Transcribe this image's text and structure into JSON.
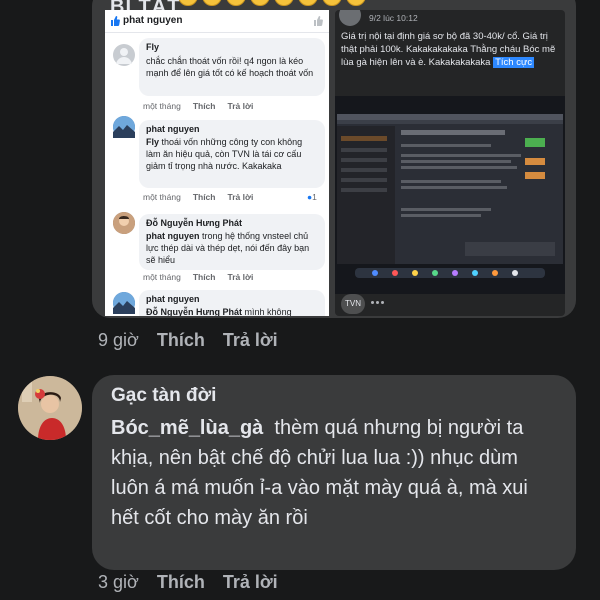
{
  "top_comment": {
    "title_fragment": "BỊ TẠT",
    "emoji_count": 8,
    "time": "9 giờ",
    "like_label": "Thích",
    "reply_label": "Trả lời"
  },
  "left_screenshot": {
    "header_name": "phat nguyen",
    "comments": [
      {
        "name": "Fly",
        "text": "chắc chắn thoát vốn rồi! q4 ngon là kéo mạnh để lên giá tốt có kế hoạch thoát vốn",
        "time": "một tháng",
        "like": "Thích",
        "reply": "Trả lời"
      },
      {
        "name": "phat nguyen",
        "mention": "Fly",
        "text": "thoái vốn những công ty con không làm ăn hiệu quả, còn TVN là tái cơ cấu giảm tỉ trọng nhà nước. Kakakaka",
        "time": "một tháng",
        "like": "Thích",
        "reply": "Trả lời",
        "reaction_count": "1"
      },
      {
        "name": "Đỗ Nguyễn Hưng Phát",
        "mention": "phat nguyen",
        "text": "trong hệ thống vnsteel chủ lực thép dài và thép dẹt, nói đến đây bạn sẽ hiểu",
        "time": "một tháng",
        "like": "Thích",
        "reply": "Trả lời"
      },
      {
        "name": "phat nguyen",
        "mention": "Đỗ Nguyễn Hưng Phát",
        "text": "mình không"
      }
    ]
  },
  "right_screenshot": {
    "meta": "9/2 lúc 10:12",
    "text": "Giá trị nội tại định giá sơ bộ đã 30-40k/ cổ. Giá trị thật phải 100k. Kakakakakaka Thằng cháu Bóc mẽ lùa gà hiện lên và è. Kakakakakaka",
    "tag": "Tích cực",
    "footer_avatar": "TVN"
  },
  "main_comment": {
    "author": "Gạc tàn đời",
    "mention": "Bóc_mẽ_lùa_gà",
    "text": "thèm quá nhưng bị người ta khịa, nên bật chế độ chửi lua lua :)) nhục dùm luôn á má muốn ỉ-a vào mặt mày quá à, mà xui hết cốt cho mày ăn rồi",
    "time": "3 giờ",
    "like_label": "Thích",
    "reply_label": "Trả lời"
  },
  "colors": {
    "background": "#18191a",
    "bubble": "#3a3b3c",
    "text": "#e4e6eb",
    "meta": "#b0b3b8",
    "link_blue": "#2d88ff"
  }
}
